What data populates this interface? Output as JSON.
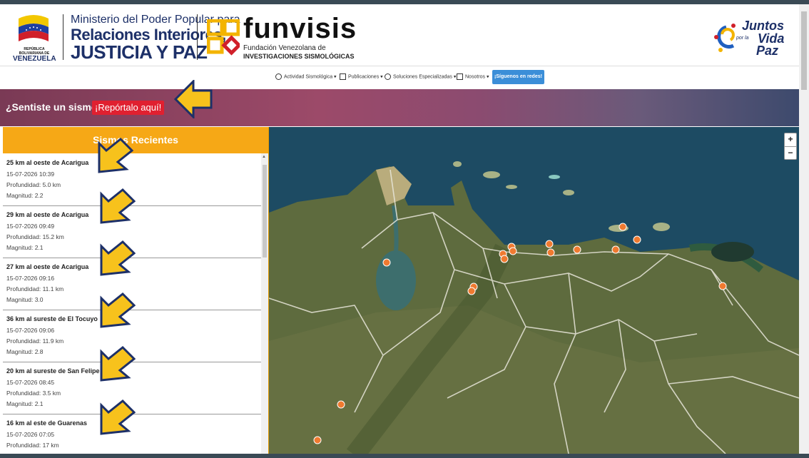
{
  "header": {
    "gov_logo_text": "REPÚBLICA BOLIVARIANA DE",
    "gov_logo_country": "VENEZUELA",
    "ministry_line1": "Ministerio del Poder Popular para",
    "ministry_line2": "Relaciones Interiores,",
    "ministry_line3": "JUSTICIA Y PAZ",
    "funvisis_name": "funvisis",
    "funvisis_sub1": "Fundación Venezolana de",
    "funvisis_sub2": "INVESTIGACIONES SISMOLÓGICAS",
    "slogan_1": "Juntos",
    "slogan_2": "por la",
    "slogan_3": "Vida",
    "slogan_4": "Paz"
  },
  "nav": {
    "items": [
      {
        "label": "Actividad Sismológica",
        "icon": "globe-icon"
      },
      {
        "label": "Publicaciones",
        "icon": "document-icon"
      },
      {
        "label": "Soluciones Especializadas",
        "icon": "gear-icon"
      },
      {
        "label": "Nosotros",
        "icon": "info-icon"
      }
    ],
    "social_button": "¡Síguenos en redes!"
  },
  "banner": {
    "question": "¿Sentiste un sismo?",
    "report_button": "¡Repórtalo aquí!"
  },
  "panel": {
    "title": "Sismos Recientes",
    "quakes": [
      {
        "title": "25 km al oeste de Acarigua",
        "datetime": "15-07-2026 10:39",
        "depth": "Profundidad: 5.0 km",
        "magnitude": "Magnitud: 2.2"
      },
      {
        "title": "29 km al oeste de Acarigua",
        "datetime": "15-07-2026 09:49",
        "depth": "Profundidad: 15.2 km",
        "magnitude": "Magnitud: 2.1"
      },
      {
        "title": "27 km al oeste de Acarigua",
        "datetime": "15-07-2026 09:16",
        "depth": "Profundidad: 11.1 km",
        "magnitude": "Magnitud: 3.0"
      },
      {
        "title": "36 km al sureste de El Tocuyo",
        "datetime": "15-07-2026 09:06",
        "depth": "Profundidad: 11.9 km",
        "magnitude": "Magnitud: 2.8"
      },
      {
        "title": "20 km al sureste de San Felipe",
        "datetime": "15-07-2026 08:45",
        "depth": "Profundidad: 3.5 km",
        "magnitude": "Magnitud: 2.1"
      },
      {
        "title": "16 km al este de Guarenas",
        "datetime": "15-07-2026 07:05",
        "depth": "Profundidad: 17 km",
        "magnitude": ""
      }
    ]
  },
  "map": {
    "zoom_in": "+",
    "zoom_out": "−",
    "colors": {
      "land": "#5e6b3e",
      "sea": "#1d4b63",
      "marker": "#f07a30",
      "border": "#e8e6da"
    }
  },
  "colors": {
    "panel_header": "#f6a816",
    "report_button": "#e02030",
    "nav_button": "#3b8ed8",
    "arrow": "#f7c21c"
  }
}
